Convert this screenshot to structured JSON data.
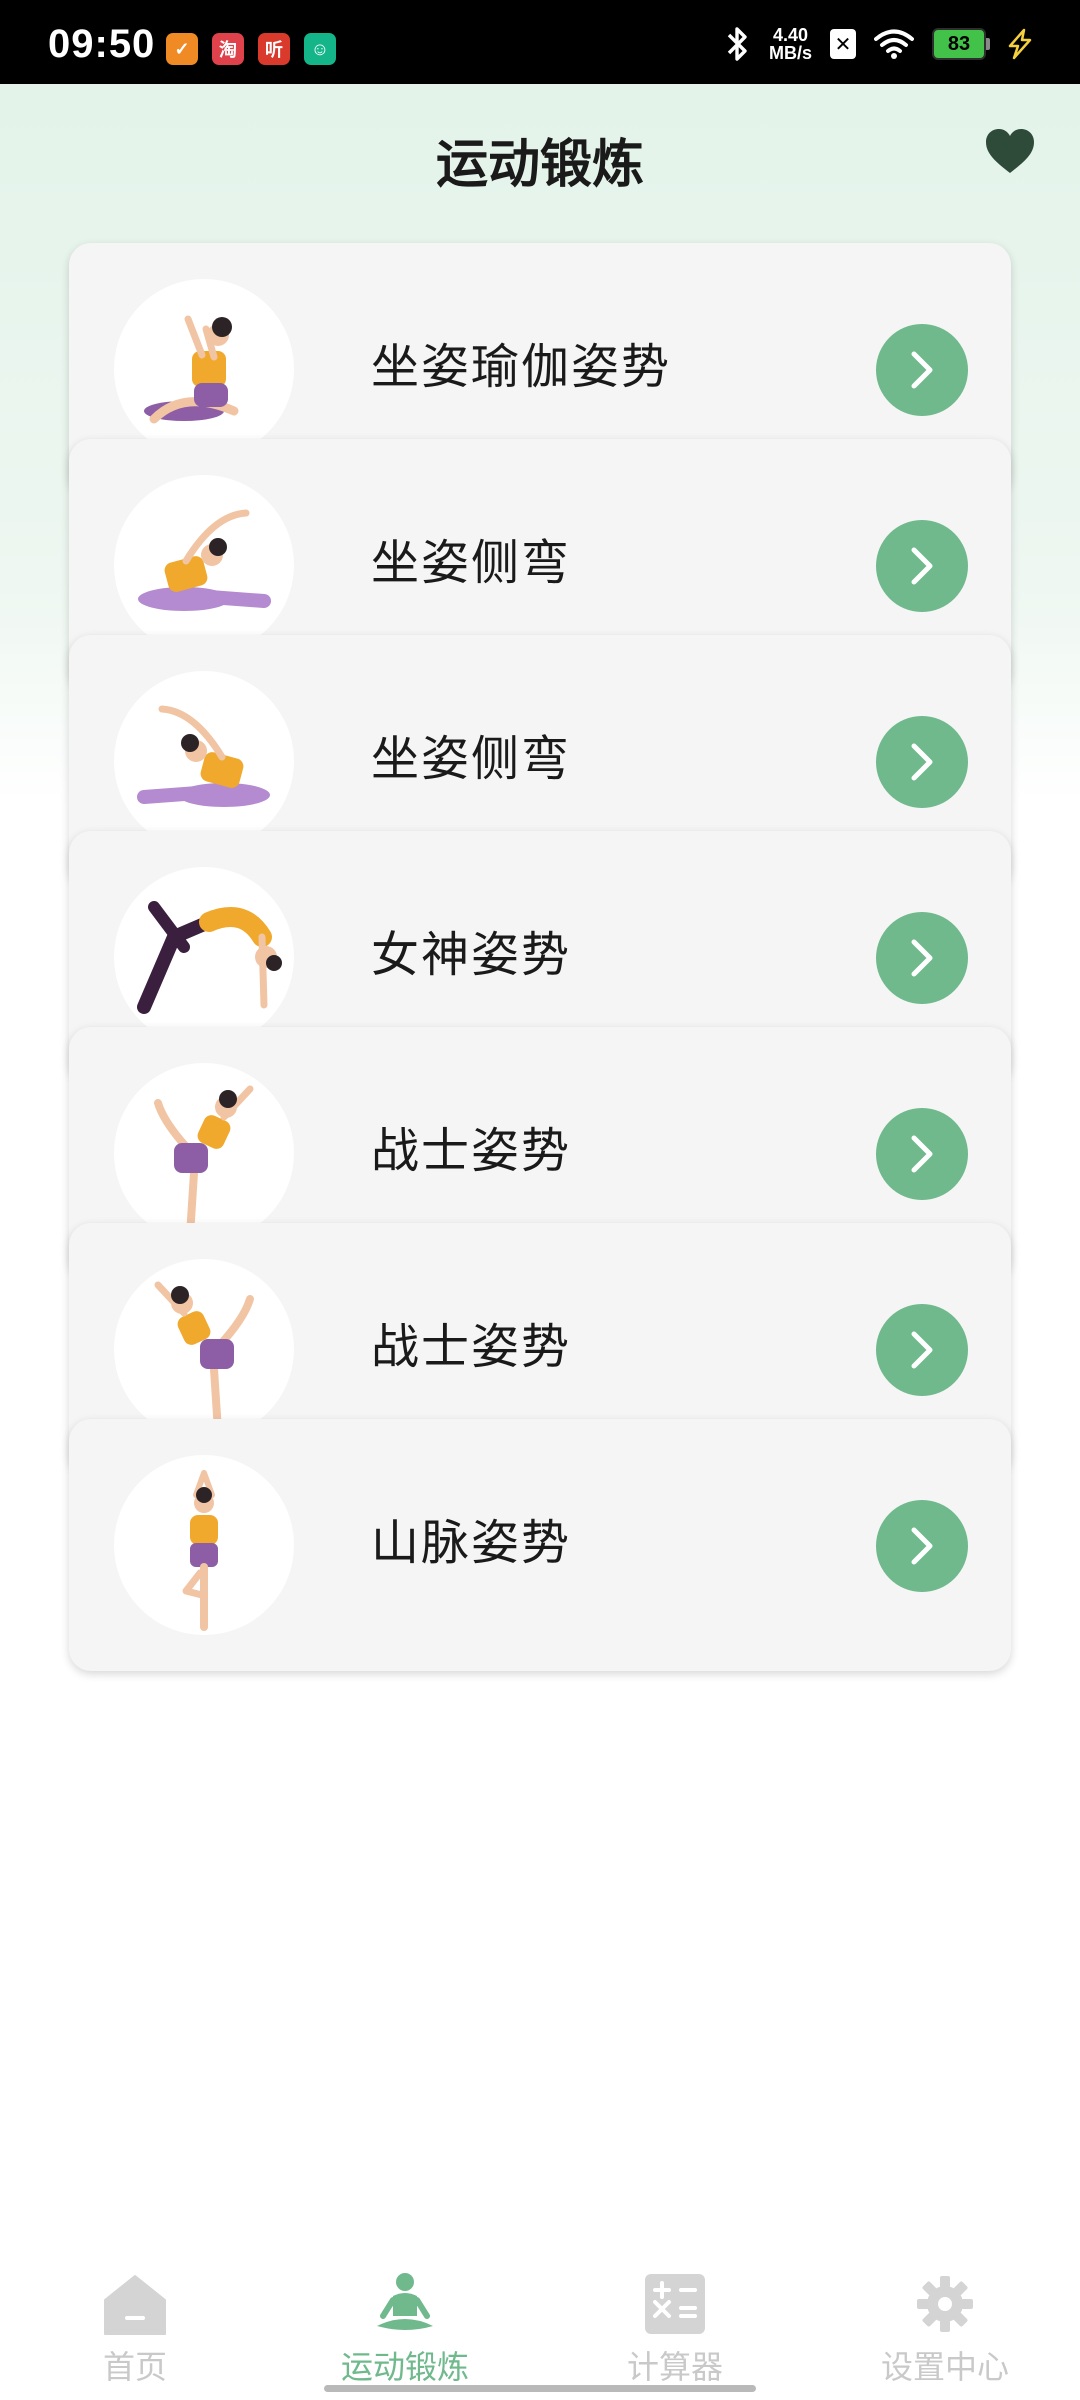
{
  "status_bar": {
    "time": "09:50",
    "apps": [
      {
        "icon": "app-orange-icon",
        "glyph": "✓",
        "color": "#f08a24"
      },
      {
        "icon": "taobao-icon",
        "glyph": "淘",
        "color": "#e0424b"
      },
      {
        "icon": "listen-icon",
        "glyph": "听",
        "color": "#d93a2b"
      },
      {
        "icon": "app-green-icon",
        "glyph": "☺",
        "color": "#15b58a"
      }
    ],
    "net_speed_value": "4.40",
    "net_speed_unit": "MB/s",
    "battery": "83"
  },
  "header": {
    "title": "运动锻炼",
    "favorite_icon": "heart-icon"
  },
  "cards": [
    {
      "title": "坐姿瑜伽姿势",
      "icon": "seated-yoga-icon"
    },
    {
      "title": "坐姿侧弯",
      "icon": "side-bend-icon"
    },
    {
      "title": "坐姿侧弯",
      "icon": "side-bend-icon"
    },
    {
      "title": "女神姿势",
      "icon": "goddess-pose-icon"
    },
    {
      "title": "战士姿势",
      "icon": "warrior-pose-icon"
    },
    {
      "title": "战士姿势",
      "icon": "warrior-pose-icon"
    },
    {
      "title": "山脉姿势",
      "icon": "mountain-pose-icon"
    }
  ],
  "tabs": [
    {
      "label": "首页",
      "icon": "home-icon",
      "active": false
    },
    {
      "label": "运动锻炼",
      "icon": "meditation-icon",
      "active": true
    },
    {
      "label": "计算器",
      "icon": "calculator-icon",
      "active": false
    },
    {
      "label": "设置中心",
      "icon": "gear-icon",
      "active": false
    }
  ],
  "colors": {
    "accent": "#6fb98c",
    "heart": "#2e4b3a",
    "tab_inactive": "#c9c9c9"
  }
}
